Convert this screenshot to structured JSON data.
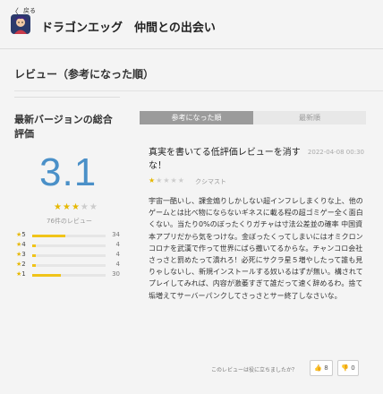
{
  "header": {
    "back_label": "戻る",
    "app_title": "ドラゴンエッグ　仲間との出会い",
    "app_icon": "app-icon"
  },
  "section": {
    "title": "レビュー（参考になった順）"
  },
  "summary": {
    "heading": "最新バージョンの総合評価",
    "score": "3.1",
    "rating_stars": 3,
    "rating_max": 5,
    "review_count": "76件のレビュー",
    "distribution": [
      {
        "label": "5",
        "count": "34",
        "fraction": 0.45
      },
      {
        "label": "4",
        "count": "4",
        "fraction": 0.05
      },
      {
        "label": "3",
        "count": "4",
        "fraction": 0.05
      },
      {
        "label": "2",
        "count": "4",
        "fraction": 0.05
      },
      {
        "label": "1",
        "count": "30",
        "fraction": 0.39
      }
    ],
    "star_color": "#e6b800",
    "bar_color": "#f0c419",
    "score_color": "#4a90c8"
  },
  "tabs": [
    {
      "label": "参考になった順",
      "active": true
    },
    {
      "label": "最新順",
      "active": false
    }
  ],
  "review": {
    "title": "真実を書いてる低評価レビューを消すな！",
    "date": "2022-04-08 00:30",
    "stars": 1,
    "author": "クシマスト",
    "body": "宇宙一酷いし、課金煽りしかしない超インフレしまくりな上、他のゲームとは比べ物にならないギネスに載る程の超ゴミゲー全く面白くない。当たり0%のぼったくりガチャは寸法公差並の確率 中国資本アプリだから気をつけな。金ぼったくってしまいにはオミクロンコロナを武漢で作って世界にばら撒いてるからな。チャンコロ会社さっさと罰めたって潰れろ！必死にサクラ星５増やしたって誰も見りゃしないし、新規インストールする奴いるはずが無い。構されてプレイしてみれば、内容が激萎すぎて誰だって速く辞めるわ。捨て垢増えてサーバーパンクしてさっさとサー終了しなさいな。",
    "helpful_prompt": "このレビューは役に立ちましたか？",
    "helpful_yes": "8",
    "helpful_no": "0"
  }
}
